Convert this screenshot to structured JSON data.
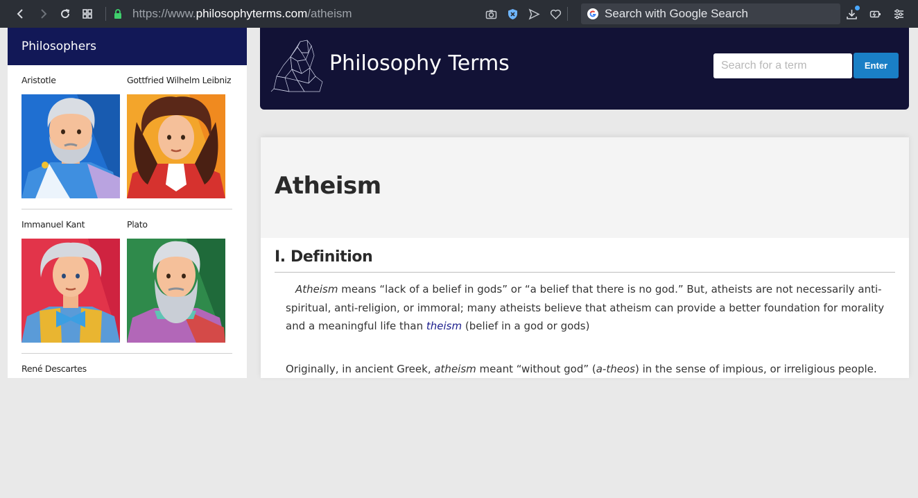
{
  "browser": {
    "url_prefix": "https://www.",
    "url_domain": "philosophyterms.com",
    "url_path": "/atheism",
    "search_placeholder": "Search with Google Search"
  },
  "sidebar": {
    "heading": "Philosophers",
    "philosophers": [
      {
        "name": "Aristotle"
      },
      {
        "name": "Gottfried Wilhelm Leibniz"
      },
      {
        "name": "Immanuel Kant"
      },
      {
        "name": "Plato"
      },
      {
        "name": "René Descartes"
      }
    ]
  },
  "header": {
    "site_title": "Philosophy Terms",
    "search_placeholder": "Search for a term",
    "enter_label": "Enter"
  },
  "article": {
    "title": "Atheism",
    "section_heading": "I. Definition",
    "p1_term": "Atheism",
    "p1_text_a": " means “lack of a belief in gods” or “a belief that there is no god.”  But, atheists are not necessarily anti-spiritual, anti-religion, or immoral; many atheists believe that atheism can provide a better foundation for morality and a meaningful life than ",
    "p1_link": "theism",
    "p1_text_b": " (belief in a god or gods)",
    "p2_text_a": "Originally, in ancient Greek, ",
    "p2_term": "atheism",
    "p2_text_b": " meant “without god” (",
    "p2_term2": "a-theos",
    "p2_text_c": ") in the sense of impious, or irreligious people."
  },
  "colors": {
    "sidebar_header": "#121857",
    "banner": "#121236",
    "enter_button": "#1a7fc6",
    "link": "#1b1d8c"
  }
}
